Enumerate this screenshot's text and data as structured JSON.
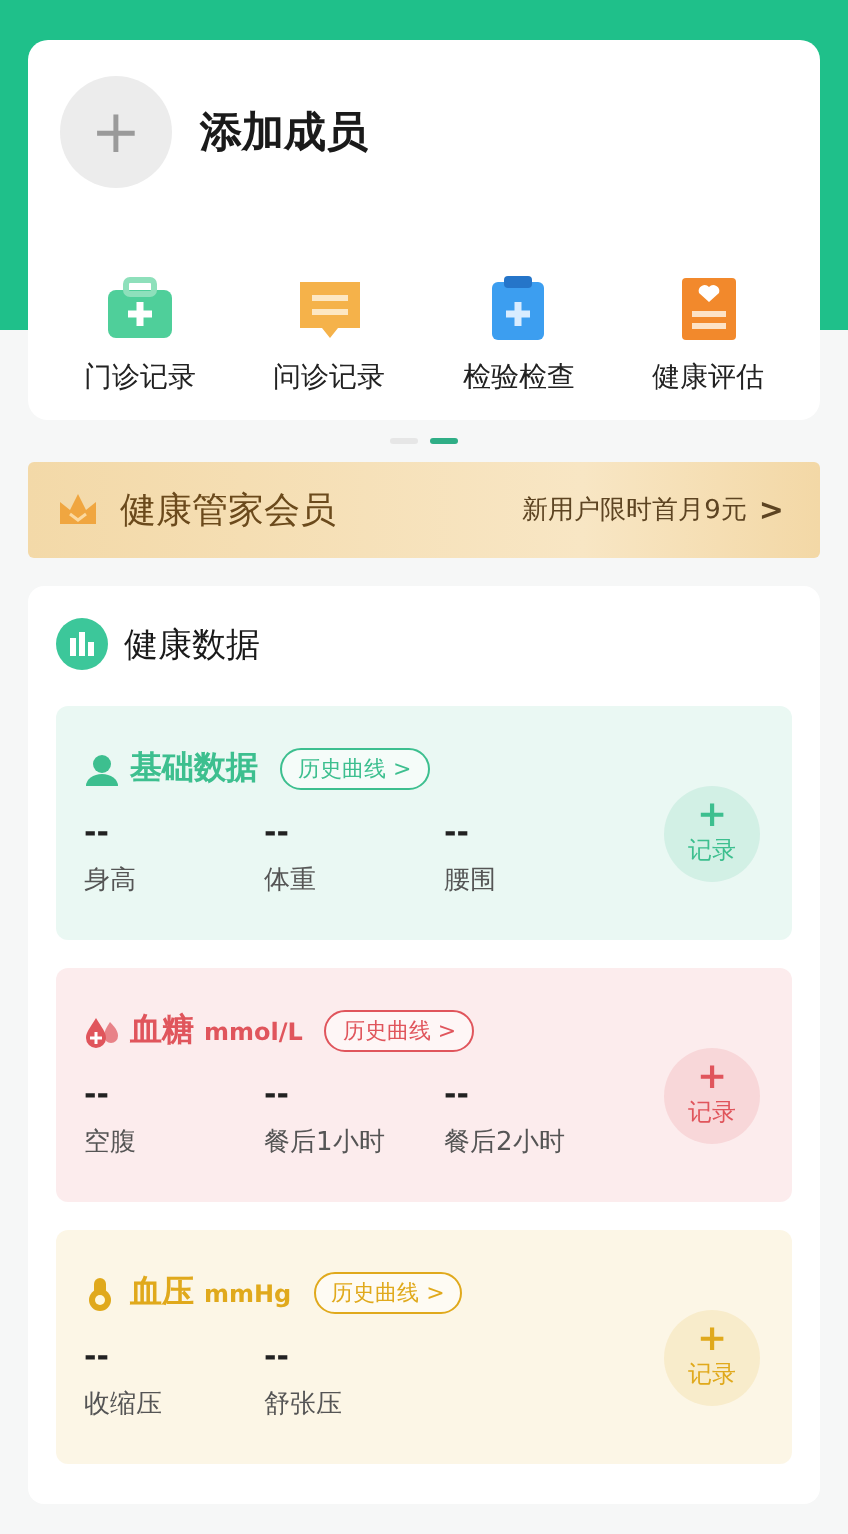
{
  "member": {
    "add_label": "+",
    "title": "添加成员"
  },
  "shortcuts": [
    {
      "kind": "kit",
      "label": "门诊记录"
    },
    {
      "kind": "chat",
      "label": "问诊记录"
    },
    {
      "kind": "clipboard",
      "label": "检验检查"
    },
    {
      "kind": "report",
      "label": "健康评估"
    }
  ],
  "pager": [
    {
      "selected": false
    },
    {
      "selected": true
    }
  ],
  "membership": {
    "title": "健康管家会员",
    "offer": "新用户限时首月9元",
    "arrow": ">"
  },
  "health_data": {
    "title": "健康数据",
    "sections": [
      {
        "kind": "person",
        "color": "#3dbf8f",
        "title": "基础数据",
        "history": "历史曲线 >",
        "record_plus": "+",
        "record": "记录",
        "metrics": [
          {
            "value": "--",
            "label": "身高"
          },
          {
            "value": "--",
            "label": "体重"
          },
          {
            "value": "--",
            "label": "腰围"
          }
        ]
      },
      {
        "kind": "drop",
        "color": "#e0555c",
        "title": "血糖",
        "unit": "mmol/L",
        "history": "历史曲线 >",
        "record_plus": "+",
        "record": "记录",
        "metrics": [
          {
            "value": "--",
            "label": "空腹"
          },
          {
            "value": "--",
            "label": "餐后1小时"
          },
          {
            "value": "--",
            "label": "餐后2小时"
          }
        ]
      },
      {
        "kind": "gauge",
        "color": "#e0a91c",
        "title": "血压",
        "unit": "mmHg",
        "history": "历史曲线 >",
        "record_plus": "+",
        "record": "记录",
        "metrics": [
          {
            "value": "--",
            "label": "收缩压"
          },
          {
            "value": "--",
            "label": "舒张压"
          }
        ]
      }
    ]
  }
}
